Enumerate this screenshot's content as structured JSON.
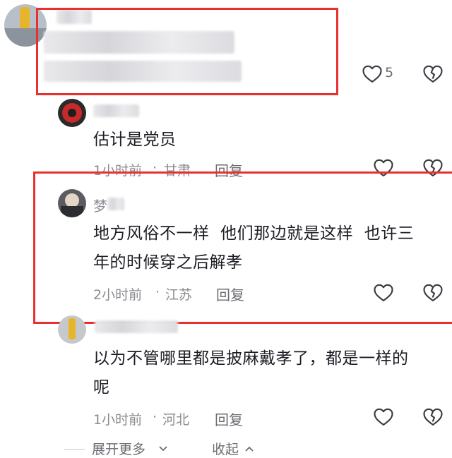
{
  "comments": [
    {
      "id": "c1",
      "likes": "5"
    },
    {
      "id": "c2",
      "text": "估计是党员",
      "time": "1小时前",
      "sep": "·",
      "location": "甘肃",
      "reply": "回复"
    },
    {
      "id": "c3",
      "name": "梦",
      "text_line1": "地方风俗不一样  他们那边就是这样  也许三",
      "text_line2": "年的时候穿之后解孝",
      "time": "2小时前",
      "sep": "·",
      "location": "江苏",
      "reply": "回复"
    },
    {
      "id": "c4",
      "text_line1": "以为不管哪里都是披麻戴孝了，都是一样的",
      "text_line2": "呢",
      "time": "1小时前",
      "sep": "·",
      "location": "河北",
      "reply": "回复"
    }
  ],
  "footer": {
    "expand": "展开更多",
    "collapse": "收起"
  },
  "colors": {
    "highlight": "#e8302f",
    "muted": "#8a8b91"
  },
  "icons": {
    "like": "heart-outline-icon",
    "dislike": "broken-heart-outline-icon",
    "expand": "chevron-down-icon",
    "collapse": "chevron-up-icon"
  }
}
